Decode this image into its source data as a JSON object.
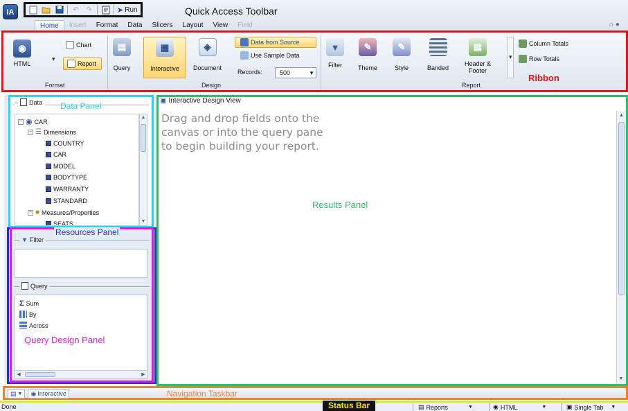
{
  "app": {
    "logo_text": "IA",
    "qat_caption": "Quick Access Toolbar",
    "qat_icons": [
      "new-icon",
      "open-icon",
      "save-icon",
      "undo-icon",
      "redo-icon",
      "preview-icon"
    ],
    "run_label": "Run",
    "help_glyph": "⌂ ●"
  },
  "tabs": [
    {
      "label": "Home",
      "state": "active"
    },
    {
      "label": "Insert",
      "state": "disabled"
    },
    {
      "label": "Format",
      "state": "normal"
    },
    {
      "label": "Data",
      "state": "normal"
    },
    {
      "label": "Slicers",
      "state": "normal"
    },
    {
      "label": "Layout",
      "state": "normal"
    },
    {
      "label": "View",
      "state": "normal"
    },
    {
      "label": "Field",
      "state": "disabled"
    }
  ],
  "ribbon": {
    "caption": "Ribbon",
    "format": {
      "group_label": "Format",
      "html_label": "HTML",
      "chart_label": "Chart",
      "report_label": "Report"
    },
    "design": {
      "group_label": "Design",
      "query_label": "Query",
      "interactive_label": "Interactive",
      "document_label": "Document",
      "data_from_source": "Data from Source",
      "use_sample_data": "Use Sample Data",
      "records_label": "Records:",
      "records_value": "500"
    },
    "report": {
      "group_label": "Report",
      "filter_label": "Filter",
      "theme_label": "Theme",
      "style_label": "Style",
      "banded_label": "Banded",
      "header_footer_line1": "Header &",
      "header_footer_line2": "Footer",
      "column_totals": "Column Totals",
      "row_totals": "Row Totals"
    }
  },
  "data_panel": {
    "tab_label": "Data",
    "caption": "Data Panel",
    "tree": {
      "root": "CAR",
      "dimensions_label": "Dimensions",
      "fields": [
        "COUNTRY",
        "CAR",
        "MODEL",
        "BODYTYPE",
        "WARRANTY",
        "STANDARD"
      ],
      "measures_label": "Measures/Properties",
      "partial_item": "SEATS"
    }
  },
  "resources_panel": {
    "caption": "Resources Panel",
    "filter_label": "Filter",
    "query_label": "Query",
    "query_items": [
      {
        "icon": "sum-icon",
        "label": "Sum"
      },
      {
        "icon": "by-icon",
        "label": "By"
      },
      {
        "icon": "across-icon",
        "label": "Across"
      }
    ],
    "qd_caption": "Query Design Panel"
  },
  "results_panel": {
    "tab_label": "Interactive Design View",
    "hint_line1": "Drag and drop fields onto the",
    "hint_line2": "canvas or into the query pane",
    "hint_line3": "to begin building your report.",
    "caption": "Results Panel"
  },
  "nav_bar": {
    "caption": "Navigation Taskbar",
    "interactive_label": "Interactive"
  },
  "status_bar": {
    "status_text": "Done",
    "caption": "Status Bar",
    "reports_label": "Reports",
    "html_label": "HTML",
    "single_tab_label": "Single Tab"
  },
  "colors": {
    "ribbon_border": "#e0141a",
    "data_panel": "#2bd4f0",
    "resources_panel": "#2032d4",
    "query_design_panel": "#e019e0",
    "results_panel": "#2fbf6a",
    "nav_taskbar": "#f07e2a",
    "status_bar": "#f2e600"
  }
}
